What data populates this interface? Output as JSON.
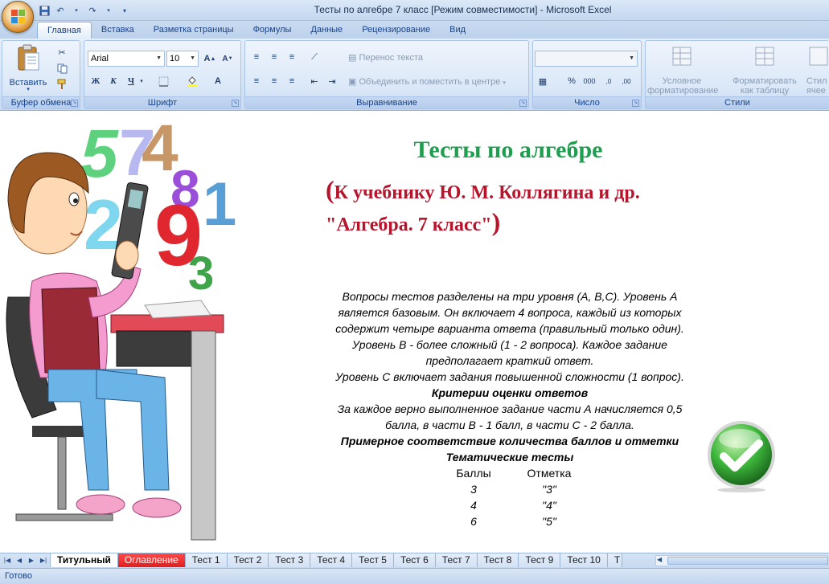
{
  "window": {
    "title": "Тесты по алгебре 7 класс  [Режим совместимости] - Microsoft Excel"
  },
  "ribbon_tabs": [
    "Главная",
    "Вставка",
    "Разметка страницы",
    "Формулы",
    "Данные",
    "Рецензирование",
    "Вид"
  ],
  "ribbon": {
    "clipboard": {
      "paste_label": "Вставить",
      "group_label": "Буфер обмена"
    },
    "font": {
      "font_name": "Arial",
      "font_size": "10",
      "group_label": "Шрифт"
    },
    "alignment": {
      "wrap_label": "Перенос текста",
      "merge_label": "Объединить и поместить в центре",
      "group_label": "Выравнивание"
    },
    "number": {
      "group_label": "Число",
      "percent": "%",
      "thousands": "000"
    },
    "styles": {
      "conditional_line1": "Условное",
      "conditional_line2": "форматирование",
      "table_line1": "Форматировать",
      "table_line2": "как таблицу",
      "cell_line1": "Стил",
      "cell_line2": "ячее",
      "group_label": "Стили"
    }
  },
  "content": {
    "title": "Тесты по алгебре",
    "subtitle_open": "(",
    "subtitle_line1": "К учебнику Ю. М. Коллягина и др.",
    "subtitle_line2": "\"Алгебра. 7 класс\"",
    "subtitle_close": ")",
    "paragraphs": [
      "Вопросы тестов разделены на три уровня (А, В,С). Уровень А",
      "является базовым. Он включает 4 вопроса, каждый из которых",
      "содержит четыре варианта ответа (правильный только один).",
      "Уровень В - более сложный (1 - 2 вопроса). Каждое задание",
      "предполагает краткий ответ.",
      "Уровень С включает задания повышенной сложности (1 вопрос)."
    ],
    "criteria_heading": "Критерии оценки ответов",
    "criteria_line1": "За каждое верно выполненное задание части А начисляется 0,5",
    "criteria_line2": "балла, в части В - 1 балл, в части С - 2 балла.",
    "correspondence_heading": "Примерное соответствие количества баллов и отметки",
    "thematic_heading": "Тематические тесты",
    "score_header": {
      "points": "Баллы",
      "grade": "Отметка"
    },
    "scores": [
      {
        "points": "3",
        "grade": "\"3\""
      },
      {
        "points": "4",
        "grade": "\"4\""
      },
      {
        "points": "6",
        "grade": "\"5\""
      }
    ],
    "digits": [
      "5",
      "7",
      "4",
      "8",
      "1",
      "2",
      "9",
      "3"
    ]
  },
  "sheet_tabs": [
    "Титульный",
    "Оглавление",
    "Тест 1",
    "Тест 2",
    "Тест 3",
    "Тест 4",
    "Тест 5",
    "Тест 6",
    "Тест 7",
    "Тест 8",
    "Тест 9",
    "Тест 10",
    "Т"
  ],
  "status": {
    "text": "Готово"
  },
  "colors": {
    "title_green": "#1f9e4f",
    "subtitle_red": "#b5142b",
    "active_tab_red": "#e01e1e"
  }
}
